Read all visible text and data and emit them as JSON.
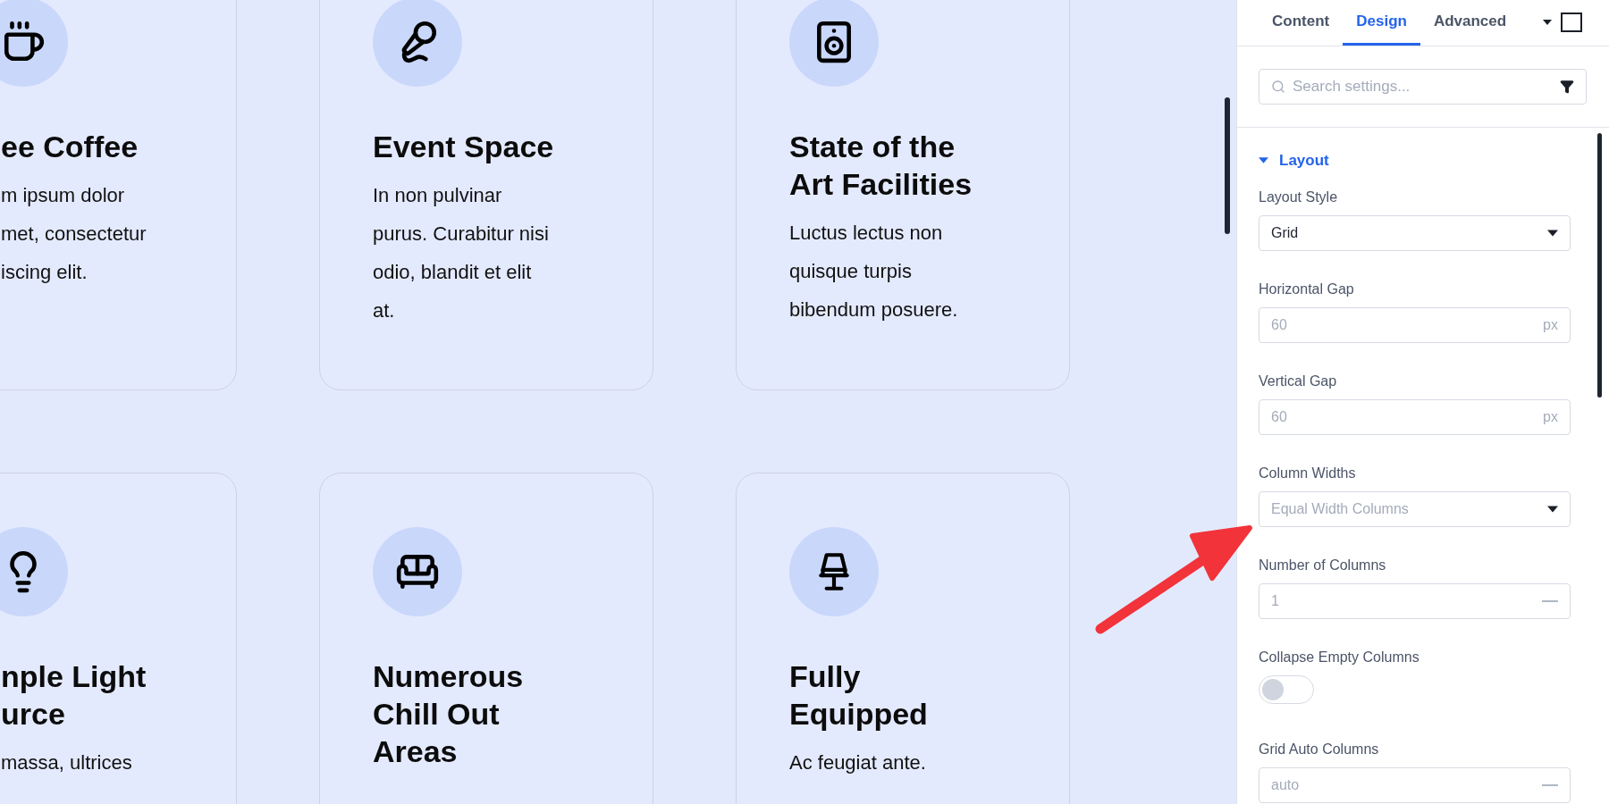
{
  "canvas": {
    "cards": [
      {
        "title_lines": [
          "ee Coffee"
        ],
        "body_lines": [
          "m ipsum dolor",
          "met, consectetur",
          "iscing elit."
        ]
      },
      {
        "title_lines": [
          "Event Space"
        ],
        "body_lines": [
          "In non pulvinar",
          "purus. Curabitur nisi",
          "odio, blandit et elit",
          "at."
        ]
      },
      {
        "title_lines": [
          "State of the",
          "Art Facilities"
        ],
        "body_lines": [
          "Luctus lectus non",
          "quisque turpis",
          "bibendum posuere."
        ]
      },
      {
        "title_lines": [
          "nple Light",
          "urce"
        ],
        "body_lines": [
          "massa, ultrices"
        ]
      },
      {
        "title_lines": [
          "Numerous",
          "Chill Out",
          "Areas"
        ]
      },
      {
        "title_lines": [
          "Fully",
          "Equipped"
        ],
        "body_lines": [
          "Ac feugiat ante."
        ]
      }
    ]
  },
  "panel": {
    "tabs": [
      {
        "label": "Content",
        "selected": false
      },
      {
        "label": "Design",
        "selected": true
      },
      {
        "label": "Advanced",
        "selected": false
      }
    ],
    "search": {
      "placeholder": "Search settings..."
    },
    "section": {
      "title": "Layout",
      "expanded": true
    },
    "fields": [
      {
        "kind": "select",
        "label": "Layout Style",
        "value": "Grid"
      },
      {
        "kind": "input",
        "label": "Horizontal Gap",
        "placeholder": "60",
        "unit": "px"
      },
      {
        "kind": "input",
        "label": "Vertical Gap",
        "placeholder": "60",
        "unit": "px"
      },
      {
        "kind": "select",
        "label": "Column Widths",
        "placeholder": "Equal Width Columns"
      },
      {
        "kind": "number",
        "label": "Number of Columns",
        "placeholder": "1"
      },
      {
        "kind": "toggle",
        "label": "Collapse Empty Columns",
        "on": false
      },
      {
        "kind": "number",
        "label": "Grid Auto Columns",
        "placeholder": "auto"
      }
    ]
  }
}
